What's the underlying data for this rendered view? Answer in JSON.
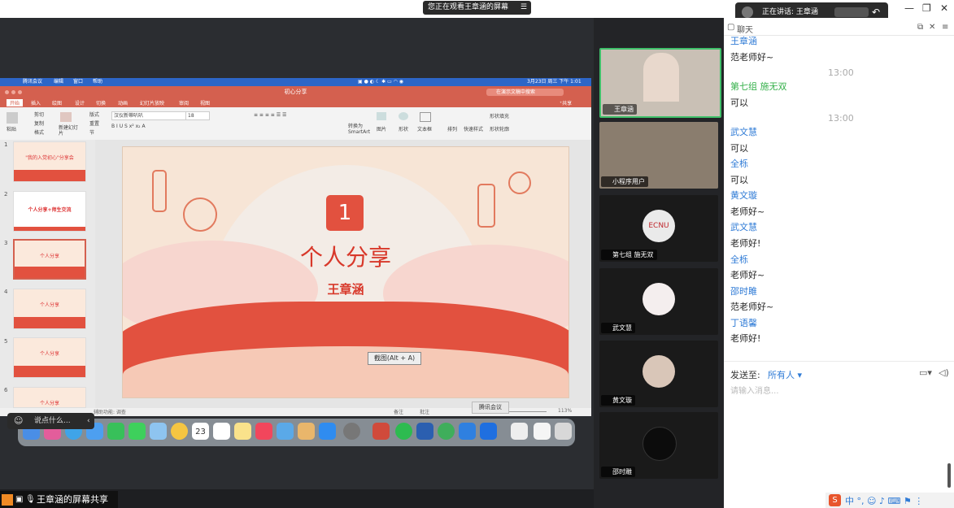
{
  "top_bar": {
    "viewing": "您正在观看王章涵的屏幕",
    "speaking": "正在讲话: 王章涵"
  },
  "mac_menubar": {
    "app": "腾讯会议",
    "items": [
      "编辑",
      "窗口",
      "帮助"
    ],
    "clock": "3月23日 周三 下午 1:01"
  },
  "ppt": {
    "file_title": "初心分享",
    "search_placeholder": "在演示文稿中搜索",
    "share": "共享",
    "tabs": [
      "开始",
      "插入",
      "绘图",
      "设计",
      "切换",
      "动画",
      "幻灯片放映",
      "审阅",
      "视图"
    ],
    "ribbon": {
      "paste": "粘贴",
      "cut": "剪切",
      "copy": "复制",
      "format": "格式",
      "new_slide": "新建幻灯片",
      "layout": "版式",
      "reset": "重置",
      "section": "节",
      "font": "汉仪新蒂叭叭",
      "font_size": "18",
      "picture": "图片",
      "shape": "形状",
      "textbox": "文本框",
      "arrange": "排列",
      "quick_styles": "快速样式",
      "shape_fill": "形状填充",
      "shape_outline": "形状轮廓",
      "convert_smartart": "转换为SmartArt"
    },
    "thumbnails": [
      {
        "num": "1",
        "title": "\"我的入党初心\"分享会"
      },
      {
        "num": "2",
        "title": "个人分享+师生交流"
      },
      {
        "num": "3",
        "title": "个人分享"
      },
      {
        "num": "4",
        "title": "个人分享"
      },
      {
        "num": "5",
        "title": "个人分享"
      },
      {
        "num": "6",
        "title": "个人分享"
      }
    ],
    "slide": {
      "number": "1",
      "title": "个人分享",
      "presenter": "王章涵"
    },
    "status": {
      "accessibility": "辅助功能: 调查",
      "notes": "备注",
      "comments": "批注",
      "zoom": "113%"
    }
  },
  "tooltips": {
    "screenshot": "截图(Alt + A)",
    "meeting": "腾讯会议"
  },
  "say_something": "说点什么...",
  "share_label": "王章涵的屏幕共享",
  "participants": [
    {
      "name": "王章涵"
    },
    {
      "name": "小程序用户"
    },
    {
      "name": "第七组 施无双",
      "avatar_text": "ECNU"
    },
    {
      "name": "武文慧"
    },
    {
      "name": "黄文璇"
    },
    {
      "name": "邵时雕"
    }
  ],
  "chat": {
    "title": "聊天",
    "messages": [
      {
        "type": "name",
        "text": "王章涵",
        "color": "blue"
      },
      {
        "type": "msg",
        "text": "范老师好~"
      },
      {
        "type": "time",
        "text": "13:00"
      },
      {
        "type": "name",
        "text": "第七组 施无双",
        "color": "green"
      },
      {
        "type": "msg",
        "text": "可以"
      },
      {
        "type": "time",
        "text": "13:00"
      },
      {
        "type": "name",
        "text": "武文慧",
        "color": "blue"
      },
      {
        "type": "msg",
        "text": "可以"
      },
      {
        "type": "name",
        "text": "全栎",
        "color": "blue"
      },
      {
        "type": "msg",
        "text": "可以"
      },
      {
        "type": "name",
        "text": "黄文璇",
        "color": "blue"
      },
      {
        "type": "msg",
        "text": "老师好~"
      },
      {
        "type": "name",
        "text": "武文慧",
        "color": "blue"
      },
      {
        "type": "msg",
        "text": "老师好!"
      },
      {
        "type": "name",
        "text": "全栎",
        "color": "blue"
      },
      {
        "type": "msg",
        "text": "老师好~"
      },
      {
        "type": "name",
        "text": "邵时雎",
        "color": "blue"
      },
      {
        "type": "msg",
        "text": "范老师好~"
      },
      {
        "type": "name",
        "text": "丁语馨",
        "color": "blue"
      },
      {
        "type": "msg",
        "text": "老师好!"
      }
    ],
    "send_to_label": "发送至:",
    "send_to_value": "所有人",
    "input_placeholder": "请输入消息..."
  },
  "colors": {
    "ppt_accent": "#d4604f",
    "slide_red": "#e2513f",
    "chat_name_blue": "#2f7bd6",
    "chat_name_green": "#35b04a"
  }
}
